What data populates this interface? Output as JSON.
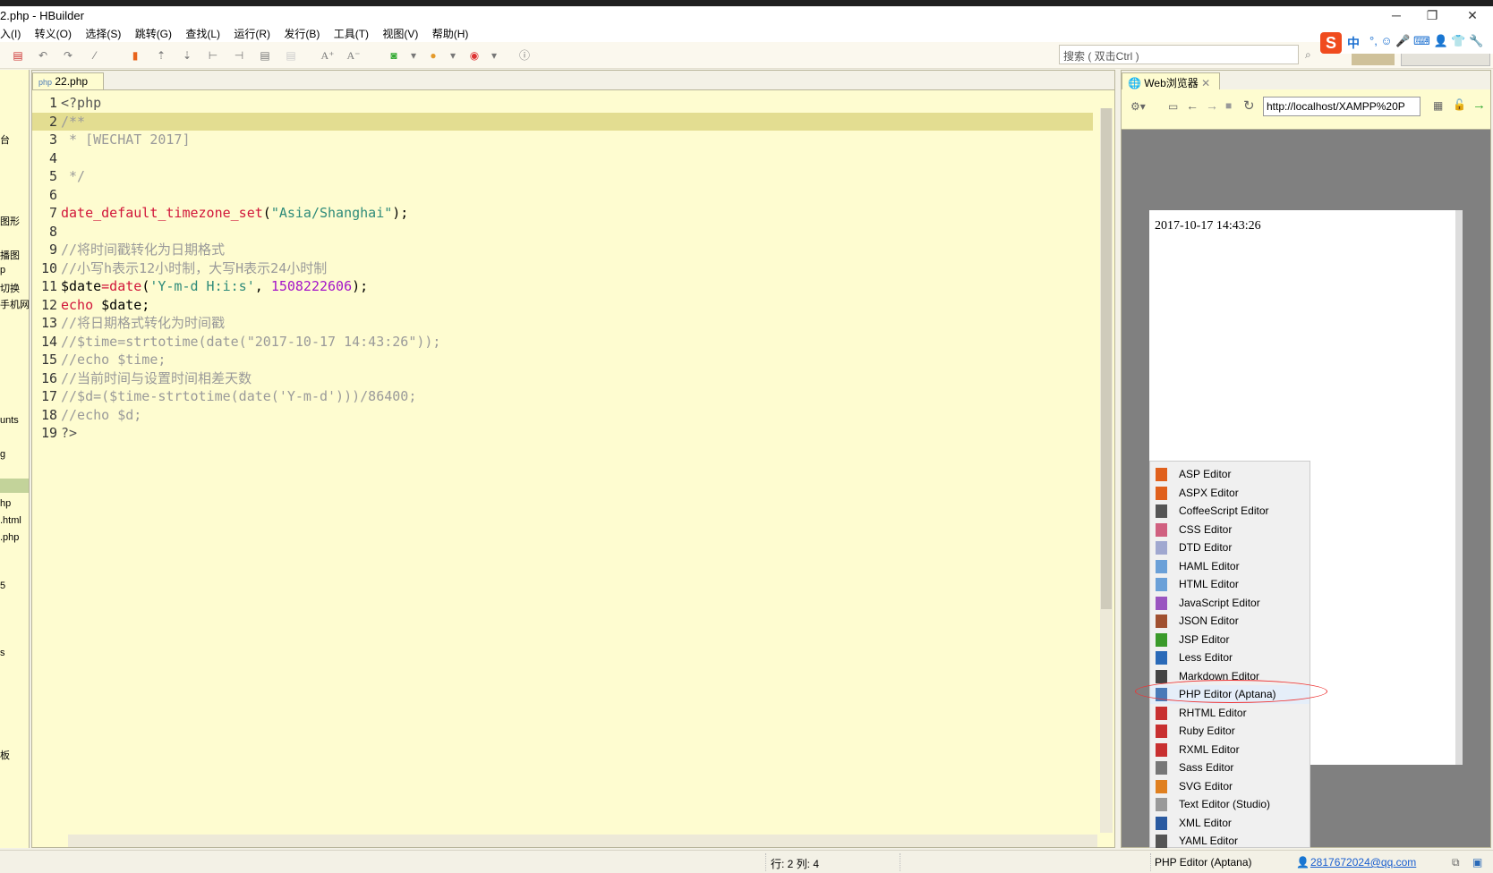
{
  "window": {
    "title": "2.php  -  HBuilder",
    "minimize": "─",
    "restore": "❐",
    "close": "✕"
  },
  "menu": [
    "入(I)",
    "转义(O)",
    "选择(S)",
    "跳转(G)",
    "查找(L)",
    "运行(R)",
    "发行(B)",
    "工具(T)",
    "视图(V)",
    "帮助(H)"
  ],
  "toolbar": {
    "search_placeholder": "搜索 ( 双击Ctrl )",
    "ime_logo": "S",
    "ime_lang": "中"
  },
  "left_panel": {
    "items": [
      "台",
      "图形",
      "播图",
      "p",
      "切换",
      "手机网",
      "unts",
      "g",
      "hp",
      ".html",
      ".php",
      "5",
      "s",
      "板"
    ]
  },
  "editor": {
    "tab": "22.php",
    "lines": [
      [
        {
          "t": "<?php",
          "c": "tag"
        }
      ],
      [
        {
          "t": "/**",
          "c": "cm"
        }
      ],
      [
        {
          "t": " * [WECHAT 2017]",
          "c": "cm"
        }
      ],
      [],
      [
        {
          "t": " */",
          "c": "cm"
        }
      ],
      [],
      [
        {
          "t": "date_default_timezone_set",
          "c": "fn"
        },
        {
          "t": "(",
          "c": ""
        },
        {
          "t": "\"Asia/Shanghai\"",
          "c": "str"
        },
        {
          "t": ");",
          "c": ""
        }
      ],
      [],
      [
        {
          "t": "//将时间戳转化为日期格式",
          "c": "cm"
        }
      ],
      [
        {
          "t": "//小写h表示12小时制，大写H表示24小时制",
          "c": "cm"
        }
      ],
      [
        {
          "t": "$date",
          "c": ""
        },
        {
          "t": "=date",
          "c": "fn"
        },
        {
          "t": "(",
          "c": ""
        },
        {
          "t": "'Y-m-d H:i:s'",
          "c": "str"
        },
        {
          "t": ", ",
          "c": ""
        },
        {
          "t": "1508222606",
          "c": "num"
        },
        {
          "t": ");",
          "c": ""
        }
      ],
      [
        {
          "t": "echo",
          "c": "fn"
        },
        {
          "t": " $date;",
          "c": ""
        }
      ],
      [
        {
          "t": "//将日期格式转化为时间戳",
          "c": "cm"
        }
      ],
      [
        {
          "t": "//$time=strtotime(date(\"2017-10-17 14:43:26\"));",
          "c": "cm"
        }
      ],
      [
        {
          "t": "//echo $time;",
          "c": "cm"
        }
      ],
      [
        {
          "t": "//当前时间与设置时间相差天数",
          "c": "cm"
        }
      ],
      [
        {
          "t": "//$d=($time-strtotime(date('Y-m-d')))/86400;",
          "c": "cm"
        }
      ],
      [
        {
          "t": "//echo $d;",
          "c": "cm"
        }
      ],
      [
        {
          "t": "?>",
          "c": "tag"
        }
      ]
    ],
    "highlighted_line": 2
  },
  "browser": {
    "tab": "Web浏览器",
    "url": "http://localhost/XAMPP%20P",
    "page_output": "2017-10-17 14:43:26"
  },
  "context_menu": {
    "items": [
      {
        "label": "ASP Editor",
        "color": "#e0601c"
      },
      {
        "label": "ASPX Editor",
        "color": "#e0601c"
      },
      {
        "label": "CoffeeScript Editor",
        "color": "#555555"
      },
      {
        "label": "CSS Editor",
        "color": "#d06080"
      },
      {
        "label": "DTD Editor",
        "color": "#a0a8d0"
      },
      {
        "label": "HAML Editor",
        "color": "#6aa0d8"
      },
      {
        "label": "HTML Editor",
        "color": "#6aa0d8"
      },
      {
        "label": "JavaScript Editor",
        "color": "#9a55c0"
      },
      {
        "label": "JSON Editor",
        "color": "#a05030"
      },
      {
        "label": "JSP Editor",
        "color": "#3a9a2a"
      },
      {
        "label": "Less Editor",
        "color": "#2a6ab8"
      },
      {
        "label": "Markdown Editor",
        "color": "#444444"
      },
      {
        "label": "PHP Editor (Aptana)",
        "color": "#4a7ab8"
      },
      {
        "label": "RHTML Editor",
        "color": "#c83030"
      },
      {
        "label": "Ruby Editor",
        "color": "#c83030"
      },
      {
        "label": "RXML Editor",
        "color": "#c83030"
      },
      {
        "label": "Sass Editor",
        "color": "#777777"
      },
      {
        "label": "SVG Editor",
        "color": "#e08020"
      },
      {
        "label": "Text Editor (Studio)",
        "color": "#999999"
      },
      {
        "label": "XML Editor",
        "color": "#2a5aa0"
      },
      {
        "label": "YAML Editor",
        "color": "#555555"
      }
    ],
    "circled_item": "PHP Editor (Aptana)"
  },
  "statusbar": {
    "position": "行: 2 列: 4",
    "editor_type": "PHP Editor (Aptana)",
    "user": "2817672024@qq.com"
  }
}
